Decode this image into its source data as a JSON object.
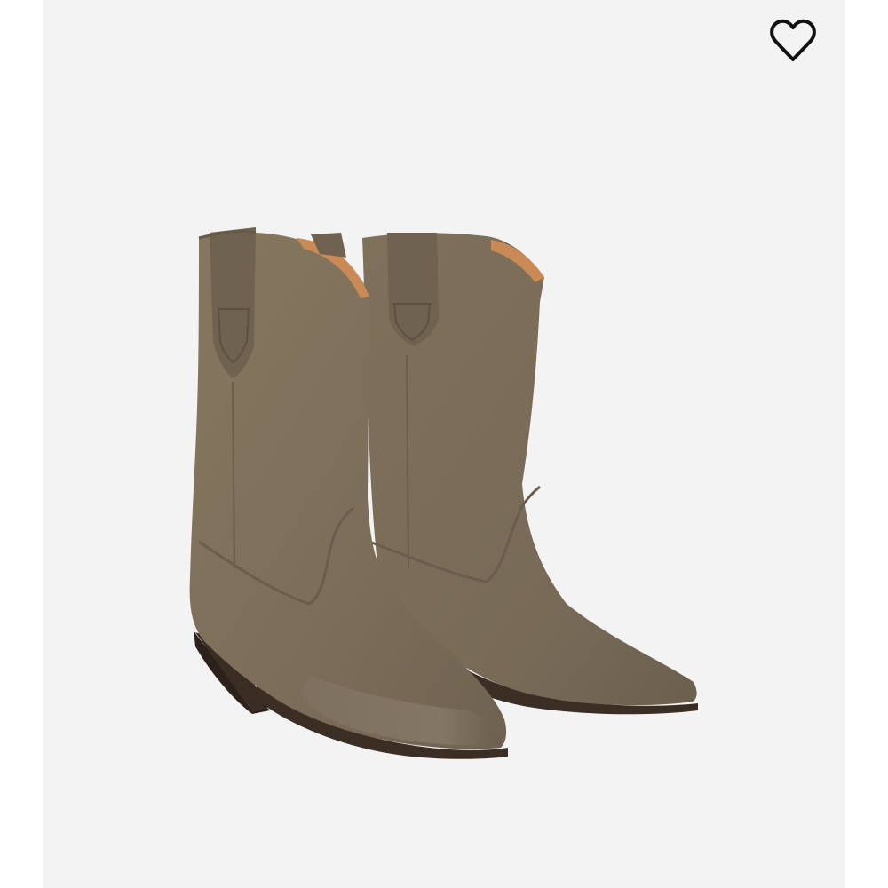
{
  "colors": {
    "panel_background": "#f3f3f3",
    "suede": "#7e705c",
    "suede_dark": "#6c5f4e",
    "lining": "#c98a55",
    "sole": "#3b2e24"
  },
  "wishlist": {
    "icon": "heart-outline-icon",
    "state": "not-favorited"
  },
  "product_image": {
    "subject": "pair-of-suede-western-boots"
  }
}
